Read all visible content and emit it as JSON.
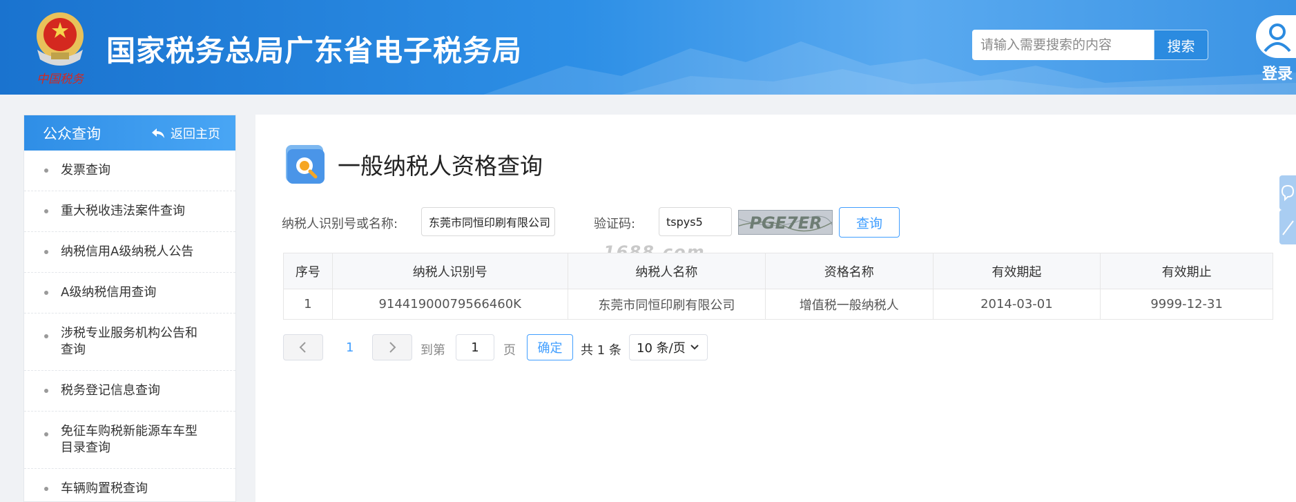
{
  "header": {
    "emblem_caption": "中国税务",
    "site_title": "国家税务总局广东省电子税务局",
    "search_placeholder": "请输入需要搜索的内容",
    "search_button": "搜索",
    "login_label": "登录"
  },
  "sidebar": {
    "title": "公众查询",
    "back_label": "返回主页",
    "items": [
      {
        "line1": "发票查询",
        "line2": ""
      },
      {
        "line1": "重大税收违法案件查询",
        "line2": ""
      },
      {
        "line1": "纳税信用A级纳税人公告",
        "line2": ""
      },
      {
        "line1": "A级纳税信用查询",
        "line2": ""
      },
      {
        "line1": "涉税专业服务机构公告和",
        "line2": "查询"
      },
      {
        "line1": "税务登记信息查询",
        "line2": ""
      },
      {
        "line1": "免征车购税新能源车车型",
        "line2": "目录查询"
      },
      {
        "line1": "车辆购置税查询",
        "line2": ""
      }
    ]
  },
  "main": {
    "page_title": "一般纳税人资格查询",
    "form": {
      "taxpayer_label": "纳税人识别号或名称:",
      "taxpayer_value": "东莞市同恒印刷有限公司",
      "captcha_label": "验证码:",
      "captcha_value": "tspys5",
      "captcha_image_text": "PGE7ER",
      "query_button": "查询"
    },
    "watermark": "1688.com",
    "table": {
      "headers": [
        "序号",
        "纳税人识别号",
        "纳税人名称",
        "资格名称",
        "有效期起",
        "有效期止"
      ],
      "rows": [
        [
          "1",
          "91441900079566460K",
          "东莞市同恒印刷有限公司",
          "增值税一般纳税人",
          "2014-03-01",
          "9999-12-31"
        ]
      ]
    },
    "pagination": {
      "current_page": "1",
      "goto_label": "到第",
      "goto_value": "1",
      "page_unit": "页",
      "confirm_button": "确定",
      "total_text": "共 1 条",
      "page_size": "10 条/页"
    }
  },
  "colors": {
    "header_blue": "#2d8fe6",
    "accent_blue": "#409eff"
  }
}
